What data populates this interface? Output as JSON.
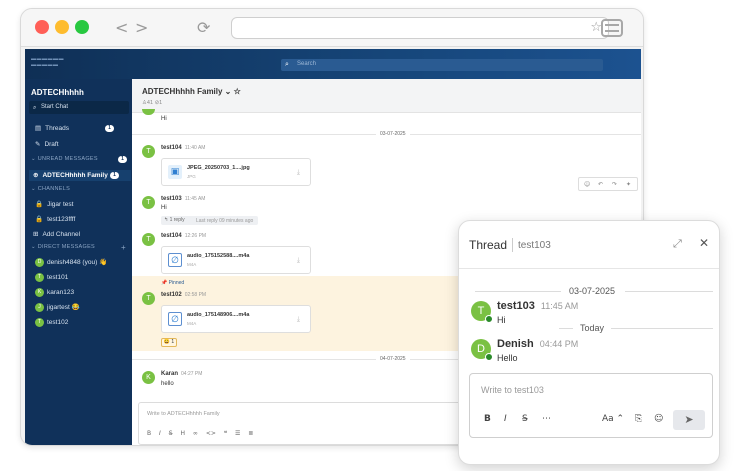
{
  "search": {
    "placeholder": "Search"
  },
  "sidebar": {
    "workspace": "ADTECHhhhh",
    "start_chat": "Start Chat",
    "threads": "Threads",
    "threads_badge": "1",
    "draft": "Draft",
    "unread_header": "UNREAD MESSAGES",
    "unread_badge": "1",
    "unread_channel": "ADTECHhhhh Family",
    "unread_channel_badge": "1",
    "channels_header": "CHANNELS",
    "channels": [
      "Jigar test",
      "test123ffff"
    ],
    "add_channel": "Add Channel",
    "dm_header": "DIRECT MESSAGES",
    "dms": [
      {
        "initial": "D",
        "name": "denish4848 (you) 👋"
      },
      {
        "initial": "T",
        "name": "test101"
      },
      {
        "initial": "K",
        "name": "karan123"
      },
      {
        "initial": "J",
        "name": "jigartest 😂"
      },
      {
        "initial": "T",
        "name": "test102"
      }
    ]
  },
  "channel": {
    "title": "ADTECHhhhh Family ⌄ ☆",
    "meta": "♙41  ⊘1"
  },
  "messages": {
    "hi_top": "Hi",
    "date1": "03-07-2025",
    "m1": {
      "initial": "T",
      "name": "test104",
      "time": "11:40 AM",
      "file_name": "JPEG_20250703_1....jpg",
      "file_sub": "JPG"
    },
    "m2": {
      "initial": "T",
      "name": "test103",
      "time": "11:45 AM",
      "text": "Hi",
      "reply_count": "↰ 1 reply",
      "last_reply": "Last reply 09 minutes ago"
    },
    "m3": {
      "initial": "T",
      "name": "test104",
      "time": "12:26 PM",
      "file_name": "audio_175152588....m4a",
      "file_sub": "M4A"
    },
    "pinned": "📌 Pinned",
    "m4": {
      "initial": "T",
      "name": "test102",
      "time": "02:58 PM",
      "file_name": "audio_175148906....m4a",
      "file_sub": "M4A",
      "reaction": "😀 1"
    },
    "date2": "04-07-2025",
    "m5": {
      "initial": "K",
      "name": "Karan",
      "time": "04:27 PM",
      "text": "hello"
    }
  },
  "composer": {
    "placeholder": "Write to ADTECHhhhh Family"
  },
  "thread": {
    "title": "Thread",
    "subtitle": "test103",
    "date": "03-07-2025",
    "msg1": {
      "initial": "T",
      "name": "test103",
      "time": "11:45 AM",
      "text": "Hi"
    },
    "today": "Today",
    "msg2": {
      "initial": "D",
      "name": "Denish",
      "time": "04:44 PM",
      "text": "Hello"
    },
    "composer_placeholder": "Write to test103"
  },
  "colors": {
    "navy": "#10315a",
    "accent_green": "#7ac143",
    "pinned_bg": "#fdf3df"
  }
}
